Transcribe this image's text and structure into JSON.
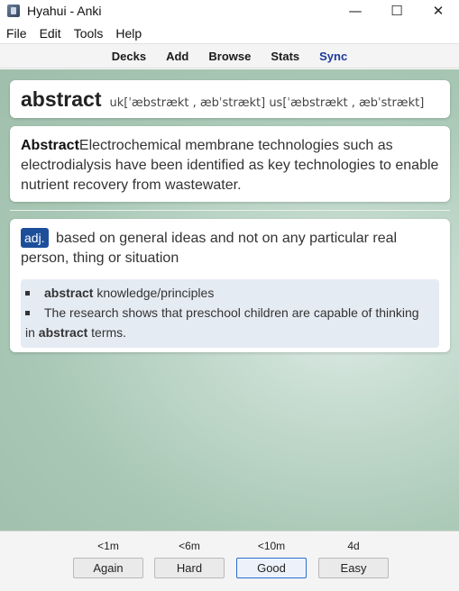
{
  "window": {
    "title": "Hyahui - Anki",
    "minimize": "—",
    "maximize": "☐",
    "close": "✕"
  },
  "menu": [
    "File",
    "Edit",
    "Tools",
    "Help"
  ],
  "toolbar": {
    "decks": "Decks",
    "add": "Add",
    "browse": "Browse",
    "stats": "Stats",
    "sync": "Sync"
  },
  "card": {
    "word": "abstract",
    "phonetic": "uk[ˈæbstrækt , æbˈstrækt] us[ˈæbstrækt , æbˈstrækt]",
    "sentence_bold": "Abstract",
    "sentence_rest": "Electrochemical membrane technologies such as electrodialysis have been identified as key technologies to enable nutrient recovery from wastewater.",
    "pos": "adj.",
    "definition": " based on general ideas and not on any particular real person, thing or situation",
    "example1_bold": "abstract",
    "example1_rest": " knowledge/principles",
    "example2_pre": "The research shows that preschool children are capable of thinking",
    "example2_cont_pre": "in ",
    "example2_bold": "abstract",
    "example2_post": " terms."
  },
  "answers": [
    {
      "time": "<1m",
      "label": "Again"
    },
    {
      "time": "<6m",
      "label": "Hard"
    },
    {
      "time": "<10m",
      "label": "Good"
    },
    {
      "time": "4d",
      "label": "Easy"
    }
  ]
}
